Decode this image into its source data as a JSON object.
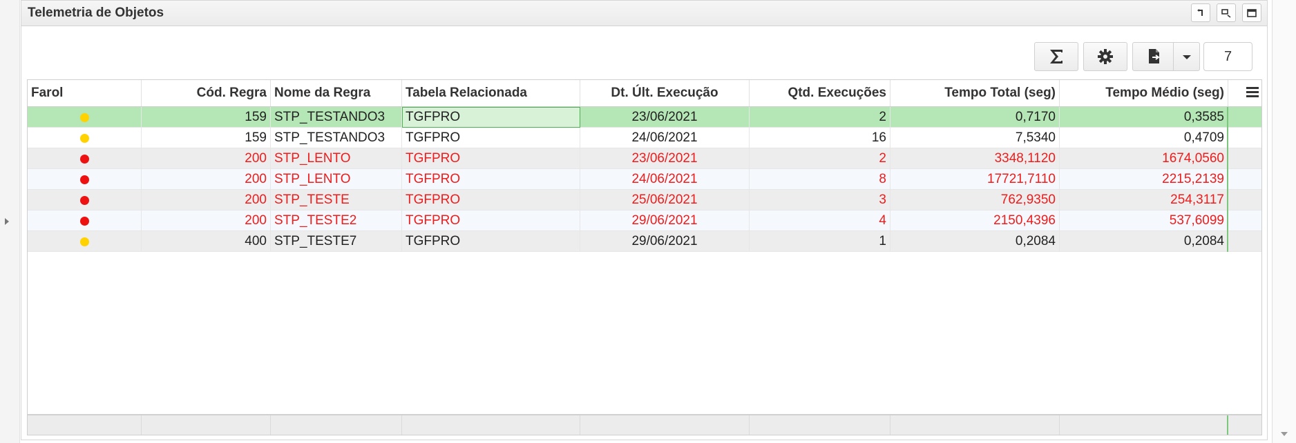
{
  "panel": {
    "title": "Telemetria de Objetos"
  },
  "toolbar": {
    "page_size": "7"
  },
  "colors": {
    "selected_row": "#b5e6b5",
    "alert_text": "#ee1c1c",
    "dot_yellow": "#ffd200",
    "dot_red": "#ee1111"
  },
  "columns": [
    "Farol",
    "Cód. Regra",
    "Nome da Regra",
    "Tabela Relacionada",
    "Dt. Últ. Execução",
    "Qtd. Execuções",
    "Tempo Total (seg)",
    "Tempo Médio (seg)"
  ],
  "rows": [
    {
      "farol": "yellow",
      "cod": "159",
      "nome": "STP_TESTANDO3",
      "tabela": "TGFPRO",
      "data": "23/06/2021",
      "qtd": "2",
      "total": "0,7170",
      "medio": "0,3585"
    },
    {
      "farol": "yellow",
      "cod": "159",
      "nome": "STP_TESTANDO3",
      "tabela": "TGFPRO",
      "data": "24/06/2021",
      "qtd": "16",
      "total": "7,5340",
      "medio": "0,4709"
    },
    {
      "farol": "red",
      "cod": "200",
      "nome": "STP_LENTO",
      "tabela": "TGFPRO",
      "data": "23/06/2021",
      "qtd": "2",
      "total": "3348,1120",
      "medio": "1674,0560"
    },
    {
      "farol": "red",
      "cod": "200",
      "nome": "STP_LENTO",
      "tabela": "TGFPRO",
      "data": "24/06/2021",
      "qtd": "8",
      "total": "17721,7110",
      "medio": "2215,2139"
    },
    {
      "farol": "red",
      "cod": "200",
      "nome": "STP_TESTE",
      "tabela": "TGFPRO",
      "data": "25/06/2021",
      "qtd": "3",
      "total": "762,9350",
      "medio": "254,3117"
    },
    {
      "farol": "red",
      "cod": "200",
      "nome": "STP_TESTE2",
      "tabela": "TGFPRO",
      "data": "29/06/2021",
      "qtd": "4",
      "total": "2150,4396",
      "medio": "537,6099"
    },
    {
      "farol": "yellow",
      "cod": "400",
      "nome": "STP_TESTE7",
      "tabela": "TGFPRO",
      "data": "29/06/2021",
      "qtd": "1",
      "total": "0,2084",
      "medio": "0,2084"
    }
  ]
}
